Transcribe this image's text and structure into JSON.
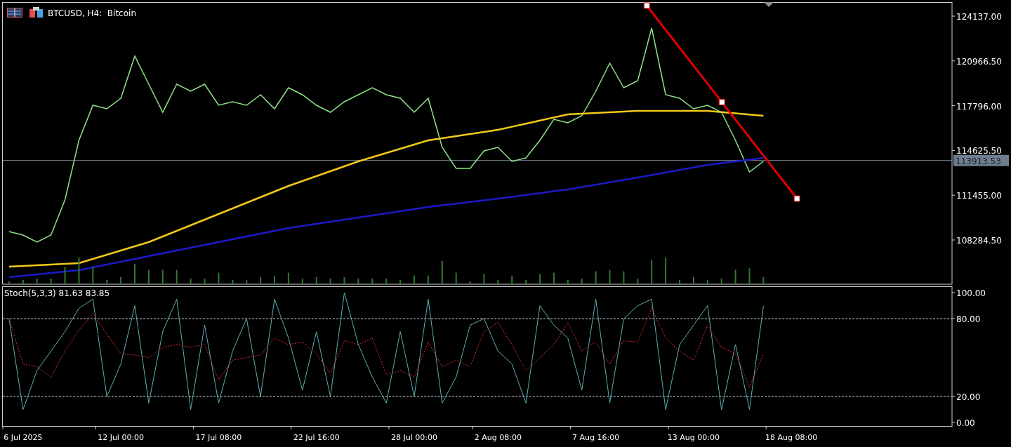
{
  "header": {
    "title": "BTCUSD, H4:  Bitcoin"
  },
  "price_chart": {
    "current_price_label": "113913.53",
    "chart_data": {
      "type": "line",
      "ylim": [
        105153,
        125131
      ],
      "series": [
        {
          "color": "#8fe388",
          "values": [
            108879,
            108631,
            108134,
            108631,
            111116,
            115340,
            117825,
            117577,
            118322,
            121304,
            119316,
            117328,
            119316,
            118819,
            119316,
            117825,
            118074,
            117825,
            118571,
            117577,
            119068,
            118571,
            117825,
            117328,
            118074,
            118571,
            119068,
            118571,
            118322,
            117328,
            118322,
            114843,
            113352,
            113352,
            114595,
            114843,
            113849,
            114098,
            115340,
            116831,
            116583,
            117080,
            118819,
            120807,
            119068,
            119565,
            123292,
            118571,
            118322,
            117577,
            117825,
            117328,
            115340,
            113104,
            113849
          ]
        },
        {
          "color": "#f2c81a",
          "values": [
            106394,
            106444,
            106494,
            106544,
            106594,
            106643,
            106941,
            107239,
            107537,
            107835,
            108134,
            108532,
            108930,
            109328,
            109726,
            110122,
            110520,
            110918,
            111316,
            111714,
            112110,
            112458,
            112806,
            113154,
            113502,
            113849,
            114147,
            114445,
            114743,
            115041,
            115340,
            115489,
            115638,
            115787,
            115936,
            116086,
            116305,
            116524,
            116743,
            116962,
            117179,
            117229,
            117279,
            117329,
            117379,
            117427,
            117427,
            117427,
            117427,
            117427,
            117427,
            117340,
            117253,
            117166,
            117080
          ]
        },
        {
          "color": "#1a1ac8",
          "values": [
            105649,
            105748,
            105847,
            105946,
            106045,
            106146,
            106345,
            106544,
            106743,
            106942,
            107140,
            107339,
            107538,
            107737,
            107936,
            108134,
            108333,
            108532,
            108731,
            108930,
            109128,
            109277,
            109426,
            109575,
            109724,
            109873,
            110022,
            110171,
            110320,
            110469,
            110619,
            110738,
            110857,
            110976,
            111095,
            111215,
            111344,
            111473,
            111602,
            111731,
            111861,
            112030,
            112199,
            112368,
            112537,
            112706,
            112885,
            113064,
            113243,
            113422,
            113601,
            113725,
            113849,
            113973,
            114098
          ]
        }
      ],
      "yticks": [
        {
          "value": 124137,
          "label": "124137.00"
        },
        {
          "value": 120966.5,
          "label": "120966.50"
        },
        {
          "value": 117796,
          "label": "117796.00"
        },
        {
          "value": 114625.5,
          "label": "114625.50"
        },
        {
          "value": 111455,
          "label": "111455.00"
        },
        {
          "value": 108284.5,
          "label": "108284.50"
        }
      ],
      "ref_lines": [
        {
          "axis": "y",
          "value": 113913.53
        }
      ]
    }
  },
  "stochastic": {
    "label": "Stoch(5,3,3) 81.63 83.85",
    "chart_data": {
      "type": "line",
      "ylim": [
        -3.2,
        104.9
      ],
      "categories": [
        null,
        "6 Jul 2025",
        null,
        null,
        null,
        null,
        null,
        null,
        "12 Jul 00:00",
        null,
        null,
        null,
        null,
        null,
        null,
        "17 Jul 08:00",
        null,
        null,
        null,
        null,
        null,
        null,
        "22 Jul 16:00",
        null,
        null,
        null,
        null,
        null,
        null,
        "28 Jul 00:00",
        null,
        null,
        null,
        null,
        null,
        "2 Aug 08:00",
        null,
        null,
        null,
        null,
        null,
        null,
        "7 Aug 16:00",
        null,
        null,
        null,
        null,
        null,
        null,
        "13 Aug 00:00",
        null,
        null,
        null,
        null,
        null,
        null,
        "18 Aug 08:00",
        null,
        null,
        null,
        null,
        null,
        null,
        null,
        null,
        null,
        null,
        null
      ],
      "series": [
        {
          "color": "#5fb0b0",
          "values": [
            80,
            10,
            40,
            55,
            70,
            88,
            95,
            20,
            45,
            90,
            15,
            70,
            95,
            10,
            75,
            15,
            55,
            80,
            20,
            95,
            65,
            25,
            70,
            20,
            100,
            60,
            35,
            15,
            70,
            20,
            95,
            15,
            35,
            75,
            80,
            55,
            45,
            15,
            90,
            75,
            65,
            25,
            95,
            15,
            80,
            90,
            95,
            10,
            60,
            75,
            90,
            10,
            60,
            10,
            90,
            null,
            null,
            null,
            null,
            null,
            null,
            null,
            null,
            null,
            null,
            null,
            null,
            null
          ]
        },
        {
          "color": "#e03030",
          "line_style": "dashed",
          "values": [
            80,
            45,
            43,
            35,
            55,
            71,
            84,
            68,
            53,
            52,
            50,
            58,
            60,
            58,
            60,
            33,
            48,
            50,
            52,
            65,
            60,
            62,
            53,
            38,
            63,
            60,
            65,
            37,
            40,
            35,
            62,
            43,
            48,
            43,
            70,
            77,
            60,
            40,
            50,
            60,
            77,
            55,
            62,
            45,
            63,
            62,
            88,
            65,
            55,
            48,
            75,
            58,
            53,
            27,
            53,
            null,
            null,
            null,
            null,
            null,
            null,
            null,
            null,
            null,
            null,
            null,
            null,
            null
          ]
        }
      ],
      "yticks": [
        {
          "value": 100,
          "label": "100.00"
        },
        {
          "value": 80,
          "label": "80.00"
        },
        {
          "value": 20,
          "label": "20.00"
        },
        {
          "value": 0,
          "label": "0.00"
        }
      ],
      "ref_lines": [
        {
          "axis": "y",
          "value": 80
        },
        {
          "axis": "y",
          "value": 20
        }
      ]
    }
  }
}
